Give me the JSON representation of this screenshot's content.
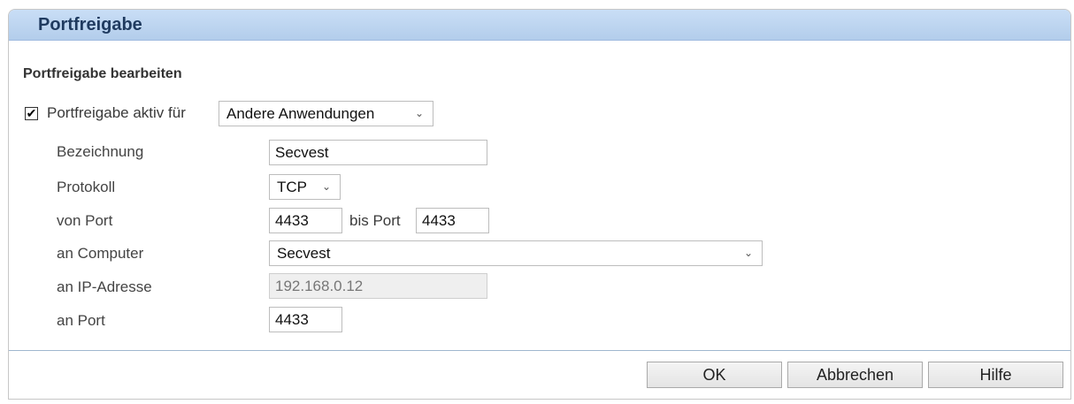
{
  "header": {
    "title": "Portfreigabe"
  },
  "section": {
    "title": "Portfreigabe bearbeiten"
  },
  "active": {
    "checked": true,
    "label": "Portfreigabe aktiv für",
    "application_select": "Andere Anwendungen"
  },
  "form": {
    "bezeichnung": {
      "label": "Bezeichnung",
      "value": "Secvest"
    },
    "protokoll": {
      "label": "Protokoll",
      "value": "TCP"
    },
    "von_port": {
      "label": "von Port",
      "value": "4433",
      "bis_label": "bis Port",
      "bis_value": "4433"
    },
    "computer": {
      "label": "an Computer",
      "value": "Secvest"
    },
    "ip": {
      "label": "an IP-Adresse",
      "value": "192.168.0.12"
    },
    "port": {
      "label": "an Port",
      "value": "4433"
    }
  },
  "buttons": {
    "ok": "OK",
    "cancel": "Abbrechen",
    "help": "Hilfe"
  }
}
